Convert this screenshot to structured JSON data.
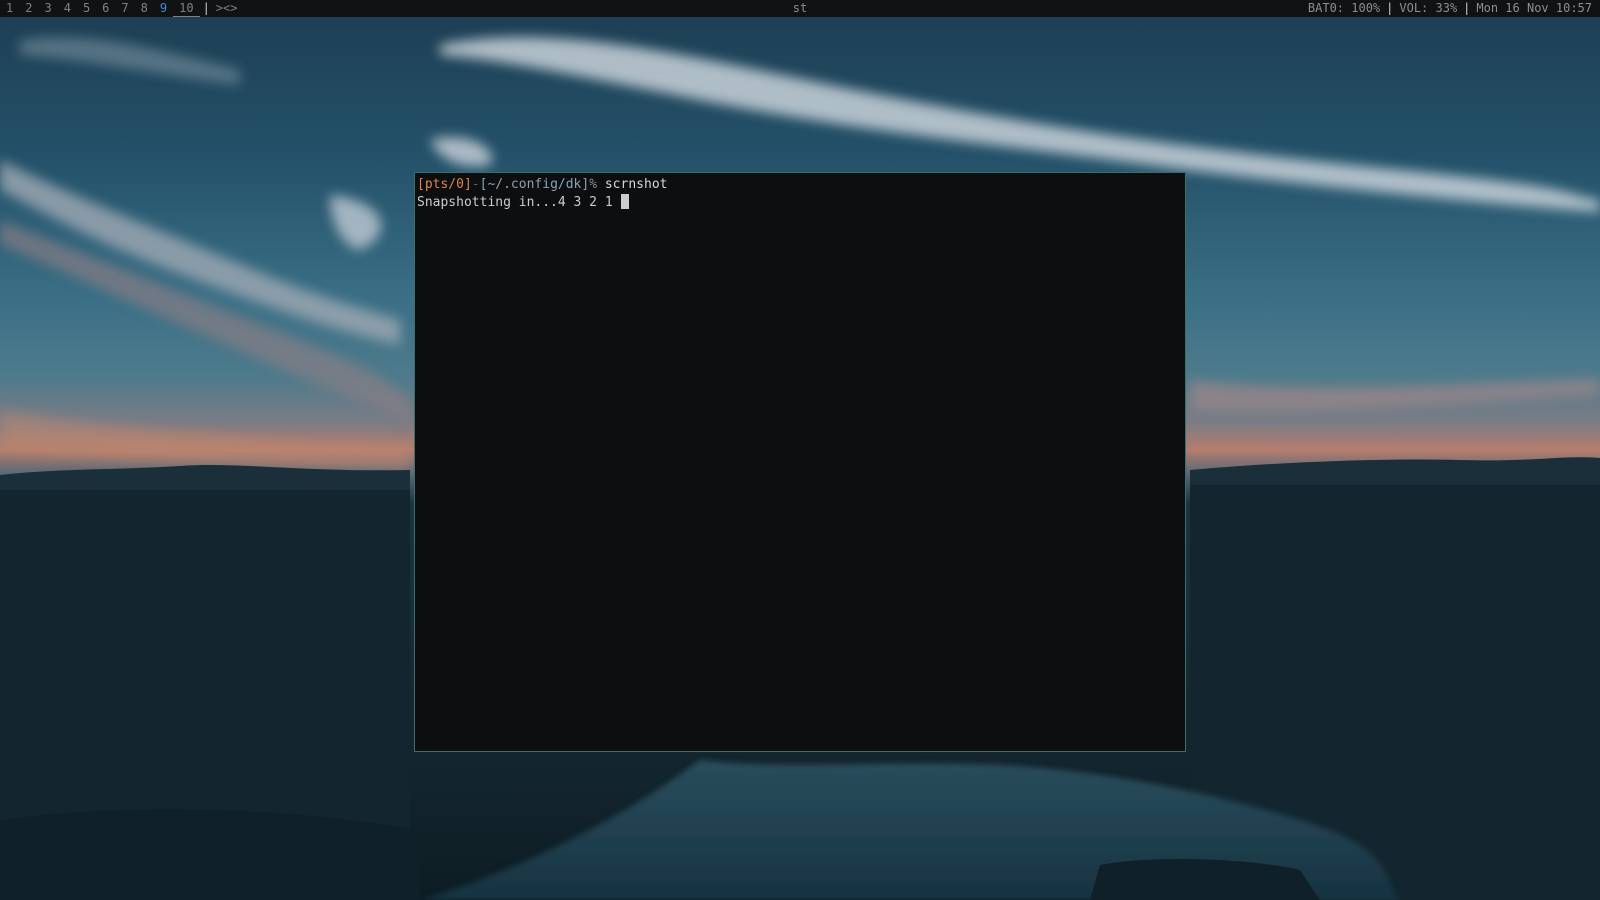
{
  "bar": {
    "workspaces": [
      {
        "label": "1",
        "active": false
      },
      {
        "label": "2",
        "active": false
      },
      {
        "label": "3",
        "active": false
      },
      {
        "label": "4",
        "active": false
      },
      {
        "label": "5",
        "active": false
      },
      {
        "label": "6",
        "active": false
      },
      {
        "label": "7",
        "active": false
      },
      {
        "label": "8",
        "active": false
      },
      {
        "label": "9",
        "active": true
      },
      {
        "label": "10",
        "active": false
      }
    ],
    "separator": "|",
    "layout_symbol": "><>",
    "window_title": "st",
    "battery": "BAT0: 100%",
    "volume": "VOL: 33%",
    "datetime": "Mon 16 Nov 10:57"
  },
  "terminal": {
    "prompt_tty": "[pts/0]",
    "prompt_dash": "-",
    "prompt_dir": "[~/.config/dk]",
    "prompt_symbol": "%",
    "command": " scrnshot",
    "output_line": "Snapshotting in...4 3 2 1 "
  },
  "colors": {
    "active_workspace": "#3d8fd6",
    "prompt_tty": "#d98650",
    "window_border": "#3e6e6a",
    "terminal_bg": "#0c0e10"
  }
}
